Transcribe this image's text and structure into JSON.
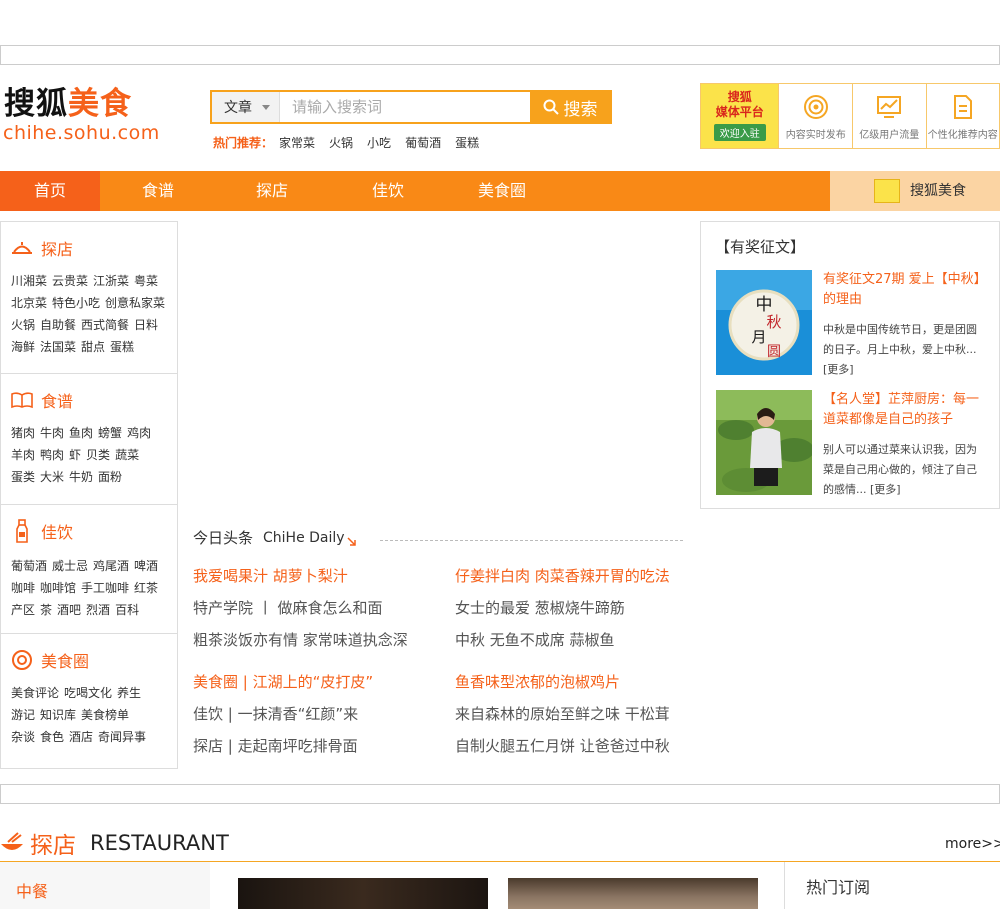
{
  "logo": {
    "cn_black": "搜狐",
    "cn_orange": "美食",
    "en": "chihe.sohu.com"
  },
  "search": {
    "type_label": "文章",
    "placeholder": "请输入搜索词",
    "button_label": "搜索",
    "hot_label": "热门推荐：",
    "hot_items": [
      "家常菜",
      "火锅",
      "小吃",
      "葡萄酒",
      "蛋糕"
    ]
  },
  "platform": {
    "title_line1": "搜狐",
    "title_line2": "媒体平台",
    "join_label": "欢迎入驻",
    "items": [
      "内容实时发布",
      "亿级用户流量",
      "个性化推荐内容"
    ]
  },
  "nav": {
    "items": [
      "首页",
      "食谱",
      "探店",
      "佳饮",
      "美食圈"
    ],
    "right_label": "搜狐美食"
  },
  "sidebar": {
    "sections": [
      {
        "title": "探店",
        "icon": "dining-icon",
        "links": [
          "川湘菜",
          "云贵菜",
          "江浙菜",
          "粤菜",
          "北京菜",
          "特色小吃",
          "创意私家菜",
          "火锅",
          "自助餐",
          "西式简餐",
          "日料",
          "海鲜",
          "法国菜",
          "甜点",
          "蛋糕"
        ]
      },
      {
        "title": "食谱",
        "icon": "book-icon",
        "links": [
          "猪肉",
          "牛肉",
          "鱼肉",
          "螃蟹",
          "鸡肉",
          "羊肉",
          "鸭肉",
          "虾",
          "贝类",
          "蔬菜",
          "蛋类",
          "大米",
          "牛奶",
          "面粉"
        ]
      },
      {
        "title": "佳饮",
        "icon": "bottle-icon",
        "links": [
          "葡萄酒",
          "威士忌",
          "鸡尾酒",
          "啤酒",
          "咖啡",
          "咖啡馆",
          "手工咖啡",
          "红茶",
          "产区",
          "茶",
          "酒吧",
          "烈酒",
          "百科"
        ]
      },
      {
        "title": "美食圈",
        "icon": "circle-target-icon",
        "links": [
          "美食评论",
          "吃喝文化",
          "养生",
          "游记",
          "知识库",
          "美食榜单",
          "杂谈",
          "食色",
          "酒店",
          "奇闻异事"
        ]
      }
    ]
  },
  "today": {
    "title": "今日头条",
    "subtitle": "ChiHe Daily",
    "left_col": [
      {
        "text": "我爱喝果汁 胡萝卜梨汁",
        "highlight": true
      },
      {
        "text": "特产学院 丨 做麻食怎么和面",
        "highlight": false
      },
      {
        "text": "粗茶淡饭亦有情 家常味道执念深",
        "highlight": false
      },
      {
        "text": "美食圈 | 江湖上的“皮打皮”",
        "highlight": true
      },
      {
        "text": "佳饮 | 一抹清香“红颜”来",
        "highlight": false
      },
      {
        "text": "探店 | 走起南坪吃排骨面",
        "highlight": false
      }
    ],
    "right_col": [
      {
        "text": "仔姜拌白肉 肉菜香辣开胃的吃法",
        "highlight": true
      },
      {
        "text": "女士的最爱 葱椒烧牛蹄筋",
        "highlight": false
      },
      {
        "text": "中秋 无鱼不成席 蒜椒鱼",
        "highlight": false
      },
      {
        "text": "鱼香味型浓郁的泡椒鸡片",
        "highlight": true
      },
      {
        "text": "来自森林的原始至鲜之味 干松茸",
        "highlight": false
      },
      {
        "text": "自制火腿五仁月饼 让爸爸过中秋",
        "highlight": false
      }
    ]
  },
  "promo": {
    "title": "【有奖征文】",
    "items": [
      {
        "img_text": "中秋月圆",
        "headline": "有奖征文27期 爱上【中秋】的理由",
        "desc": "中秋是中国传统节日，更是团圆的日子。月上中秋，爱上中秋...[更多]"
      },
      {
        "img_text": "",
        "headline": "【名人堂】芷萍厨房：每一道菜都像是自己的孩子",
        "desc": "别人可以通过菜来认识我，因为菜是自己用心做的，倾注了自己的感情... [更多]"
      }
    ]
  },
  "restaurant": {
    "title_cn": "探店",
    "title_en": "RESTAURANT",
    "more_label": "more>>",
    "side_item": "中餐",
    "subscribe_label": "热门订阅"
  },
  "colors": {
    "brand_orange": "#f5611a",
    "nav_orange": "#f98916",
    "search_yellow": "#f7a21c"
  }
}
